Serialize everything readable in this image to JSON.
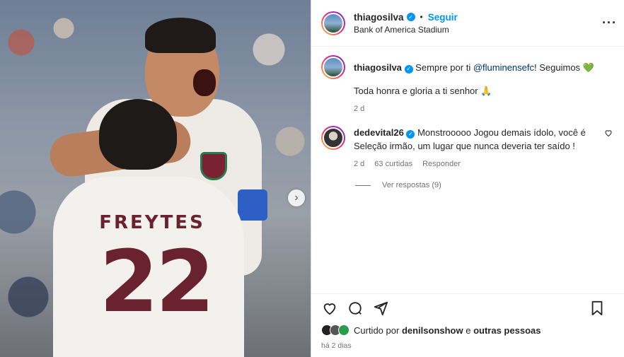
{
  "post": {
    "username": "thiagosilva",
    "follow_label": "Seguir",
    "location": "Bank of America Stadium",
    "more_icon": "more-horizontal-icon"
  },
  "photo": {
    "jersey_name": "FREYTES",
    "jersey_number": "22"
  },
  "caption": {
    "username": "thiagosilva",
    "text_before": "Sempre por ti ",
    "mention": "@fluminensefc",
    "text_after": "! Seguimos ",
    "emoji": "💚",
    "line2": "Toda honra e gloria a ti senhor ",
    "line2_emoji": "🙏",
    "time": "2 d"
  },
  "comments": [
    {
      "username": "dedevital26",
      "text": "Monstrooooo Jogou demais ídolo, você é Seleção irmão, um lugar que nunca deveria ter saído !",
      "time": "2 d",
      "likes": "63 curtidas",
      "reply_label": "Responder",
      "view_replies": "Ver respostas (9)"
    }
  ],
  "likes": {
    "prefix": "Curtido por ",
    "user": "denilsonshow",
    "middle": " e ",
    "others": "outras pessoas"
  },
  "posted_time": "há 2 dias",
  "colors": {
    "accent": "#0095f6",
    "verified": "#0095f6",
    "text": "#262626",
    "muted": "#737373",
    "jersey_text": "#6b2230"
  }
}
